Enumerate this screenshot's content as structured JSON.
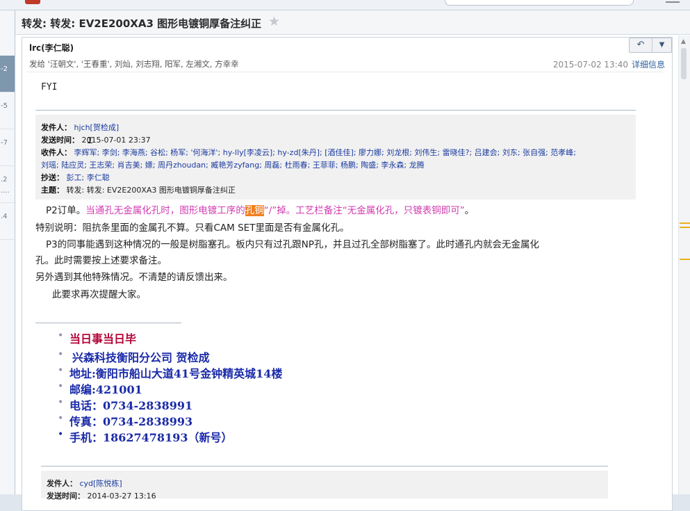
{
  "subject": "转发: 转发: EV2E200XA3 图形电镀铜厚备注纠正",
  "header": {
    "sender": "lrc(李仁聪)",
    "to": "发给 '汪朝文', '王春重', 刘灿, 刘志翔, 阳军, 左湘文, 方幸幸",
    "datetime": "2015-07-02 13:40",
    "details_link": "详细信息"
  },
  "left_list": [
    "-2",
    "-5",
    "-7",
    ".2",
    "....",
    ".4"
  ],
  "fyi": "FYI",
  "forwarded": {
    "from_label": "发件人：",
    "from_value": "hjch[贺检成]",
    "sent_label": "发送时间：",
    "sent_value": "2015-07-01 23:37",
    "to_label": "收件人：",
    "to_line1": "李辉军; 李剑; 李海燕; 谷松; 杨军; '何海洋'; hy-lly[李凌云]; hy-zd[朱丹]; [酒佳佳]; 廖力娜; 刘龙根; 刘伟生; 雷晓佳?; 吕建会; 刘东; 张自强; 范孝峰;",
    "to_line2": "刘瑶; 陆应灵; 王志荣; 肖吉美; 嫖; 周丹zhoudan; 臧艳芳zyfang; 周磊; 杜雨春; 王菲菲; 杨鹏; 陶盛; 李永森; 龙腾",
    "cc_label": "抄送：",
    "cc_value": "彭工; 李仁聪",
    "subject_label": "主题：",
    "subject_value": "转发: 转发: EV2E200XA3 图形电镀铜厚备注纠正"
  },
  "body": {
    "p1_prefix": "P2订单。",
    "p1_pink_a": "当通孔无金属化孔时，图形电镀工序的",
    "p1_highlight": "孔铜",
    "p1_pink_b": "“/”掉。工艺栏备注“无金属化孔，只镀表铜即可”",
    "p1_suffix": "。",
    "p2": "特别说明：阻抗条里面的金属孔不算。只看CAM  SET里面是否有金属化孔。",
    "p3_line1": "P3的同事能遇到这种情况的一般是树脂塞孔。板内只有过孔跟NP孔，并且过孔全部树脂塞了。此时通孔内就会无金属化",
    "p3_line2": "孔。此时需要按上述要求备注。",
    "p4": "另外遇到其他特殊情况。不清楚的请反馈出来。",
    "p5": "此要求再次提醒大家。"
  },
  "signature": [
    "当日事当日毕",
    "兴森科技衡阳分公司  贺检成",
    "地址:衡阳市船山大道41号金钟精英城14楼",
    "邮编:421001",
    "电话：0734-2838991",
    "传真：0734-2838993",
    "手机：18627478193（新号）"
  ],
  "forwarded2": {
    "from_label": "发件人：",
    "from_value": "cyd[陈悦栋]",
    "sent_label": "发送时间：",
    "sent_value": "2014-03-27 13:16"
  },
  "icons": {
    "star": "star-icon",
    "reply": "reply-arrow-icon",
    "dropdown": "chevron-down-icon"
  },
  "colors": {
    "accent_pink": "#d23bb0",
    "highlight_orange": "#f08020",
    "signature_blue": "#1a2aa8",
    "signature_red": "#b3063a"
  }
}
